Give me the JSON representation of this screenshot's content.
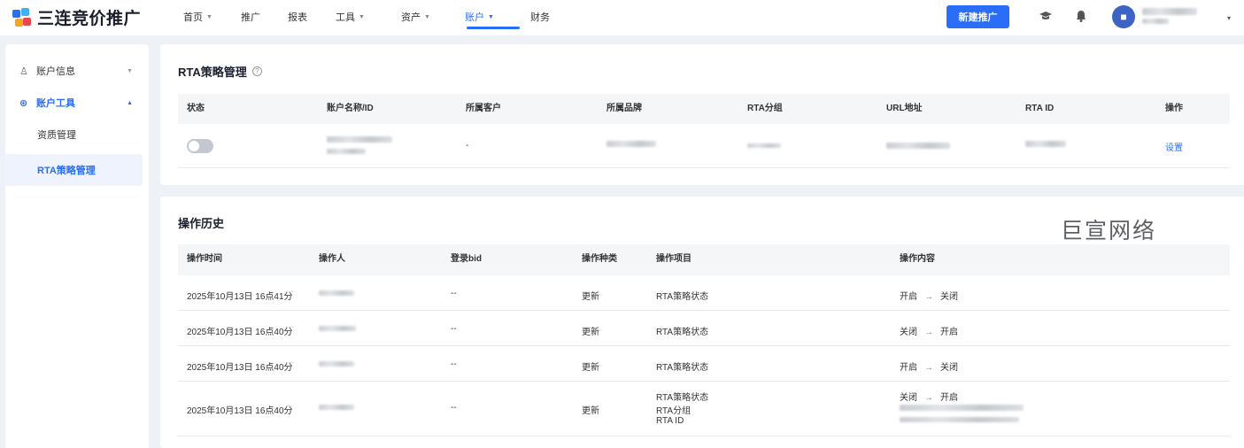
{
  "header": {
    "app_name": "三连竞价推广",
    "nav": [
      {
        "label": "首页",
        "caret": "▼"
      },
      {
        "label": "推广",
        "caret": ""
      },
      {
        "label": "报表",
        "caret": ""
      },
      {
        "label": "工具",
        "caret": "▼"
      },
      {
        "label": "资产",
        "caret": "▼"
      },
      {
        "label": "账户",
        "caret": "▼"
      },
      {
        "label": "财务",
        "caret": ""
      }
    ],
    "new_button": "新建推广",
    "accent": "#2a6df6"
  },
  "sidebar": {
    "groups": [
      {
        "label": "账户信息",
        "icon": "user-icon",
        "caret": "▼"
      },
      {
        "label": "账户工具",
        "icon": "tool-icon",
        "caret": "▲"
      }
    ],
    "sub_items": [
      {
        "label": "资质管理"
      },
      {
        "label": "RTA策略管理"
      }
    ]
  },
  "rta": {
    "title": "RTA策略管理",
    "help": "?",
    "columns": [
      "状态",
      "账户名称/ID",
      "所属客户",
      "所属品牌",
      "RTA分组",
      "URL地址",
      "RTA ID",
      "操作"
    ],
    "row": {
      "client": "-",
      "action": "设置"
    }
  },
  "history": {
    "title": "操作历史",
    "columns": [
      "操作时间",
      "操作人",
      "登录bid",
      "操作种类",
      "操作项目",
      "操作内容"
    ],
    "rows": [
      {
        "time": "2025年10月13日 16点41分",
        "bid": "--",
        "kind": "更新",
        "items": [
          "RTA策略状态"
        ],
        "from": "开启",
        "to": "关闭"
      },
      {
        "time": "2025年10月13日 16点40分",
        "bid": "--",
        "kind": "更新",
        "items": [
          "RTA策略状态"
        ],
        "from": "关闭",
        "to": "开启"
      },
      {
        "time": "2025年10月13日 16点40分",
        "bid": "--",
        "kind": "更新",
        "items": [
          "RTA策略状态"
        ],
        "from": "开启",
        "to": "关闭"
      },
      {
        "time": "2025年10月13日 16点40分",
        "bid": "--",
        "kind": "更新",
        "items": [
          "RTA策略状态",
          "RTA分组",
          "RTA ID"
        ],
        "from": "关闭",
        "to": "开启"
      }
    ],
    "arrow": "→"
  },
  "watermark": "巨宣网络"
}
